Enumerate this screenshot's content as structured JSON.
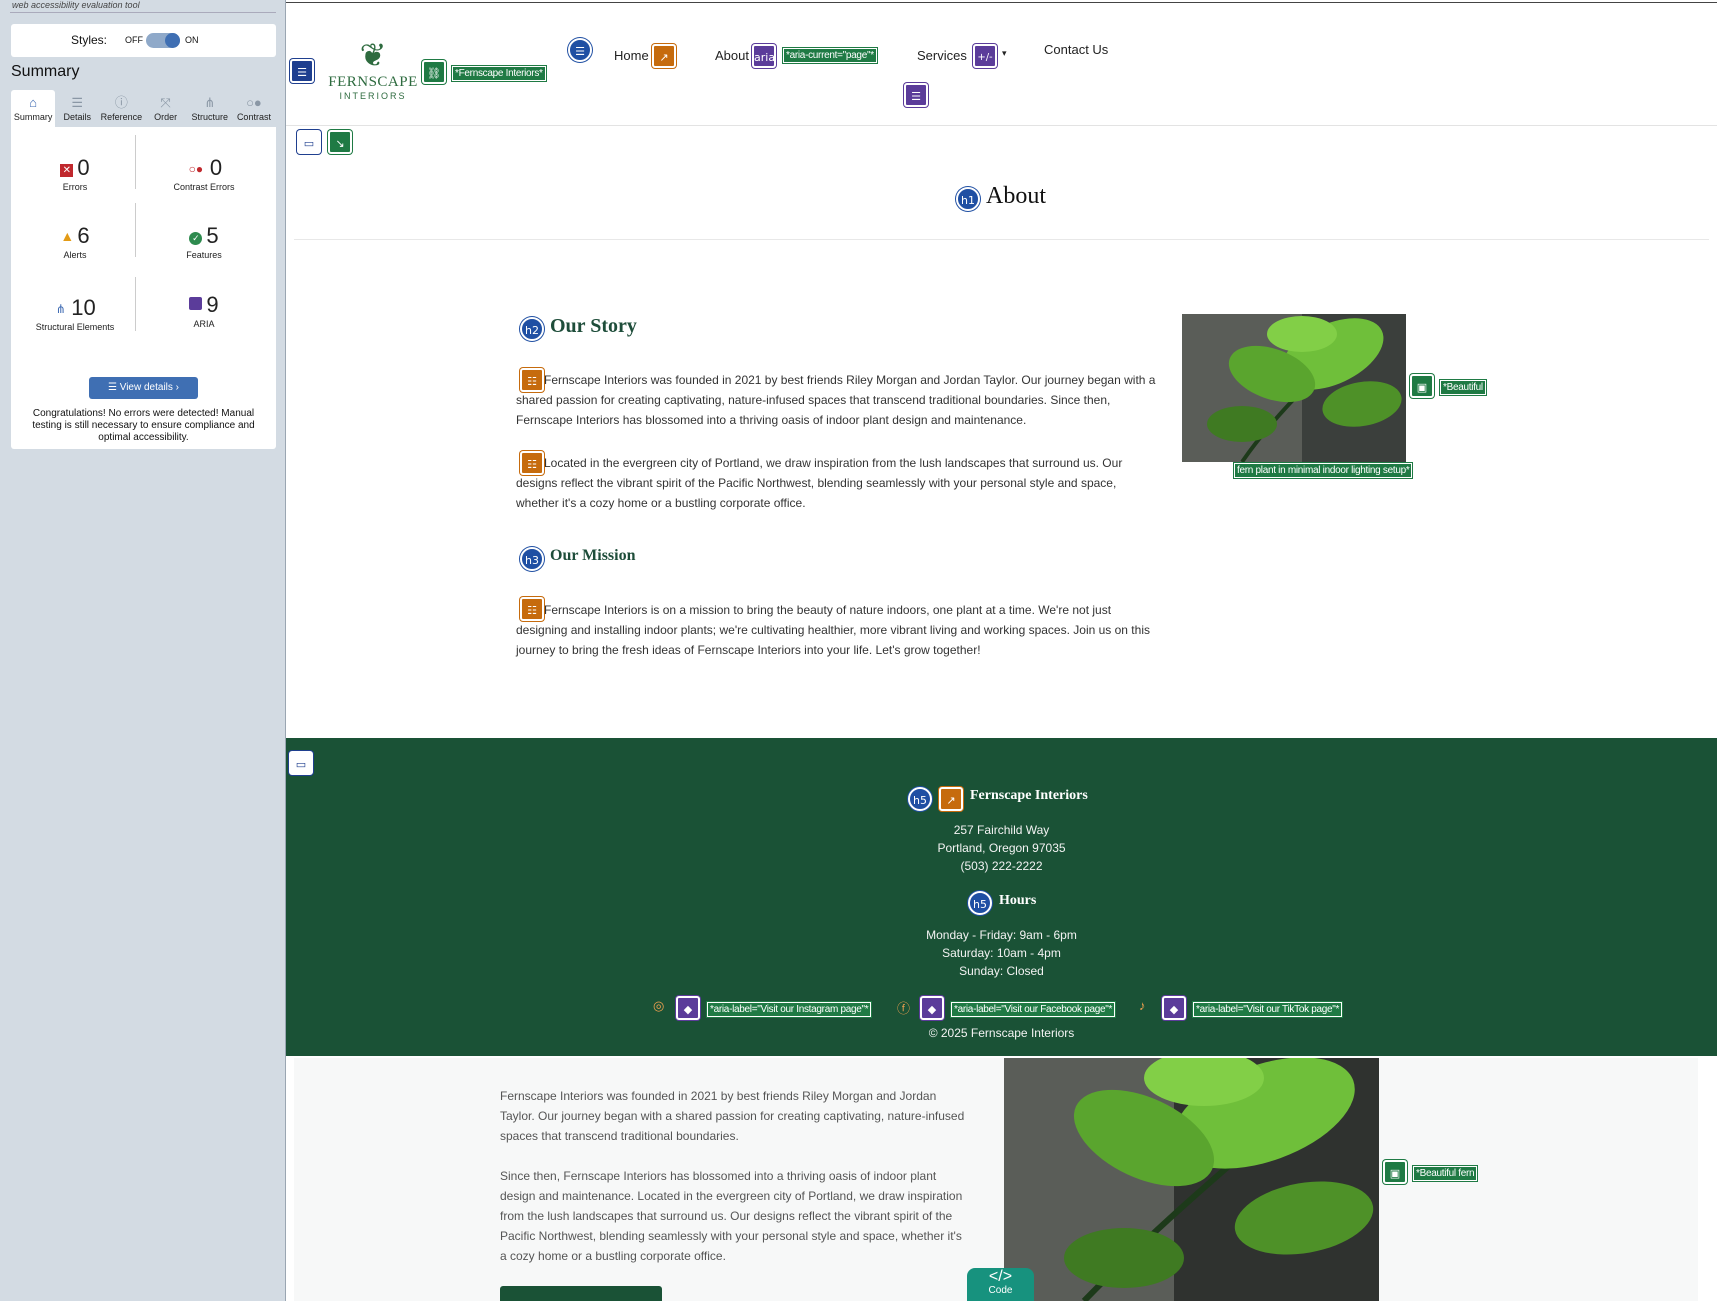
{
  "wave": {
    "tool_tag": "web accessibility evaluation tool",
    "styles_label": "Styles:",
    "off_label": "OFF",
    "on_label": "ON",
    "summary_title": "Summary",
    "tabs": [
      {
        "label": "Summary",
        "icon": "home-icon"
      },
      {
        "label": "Details",
        "icon": "list-icon"
      },
      {
        "label": "Reference",
        "icon": "info-icon"
      },
      {
        "label": "Order",
        "icon": "order-icon"
      },
      {
        "label": "Structure",
        "icon": "structure-icon"
      },
      {
        "label": "Contrast",
        "icon": "contrast-icon"
      }
    ],
    "stats": {
      "errors": {
        "value": "0",
        "label": "Errors"
      },
      "contrast": {
        "value": "0",
        "label": "Contrast Errors"
      },
      "alerts": {
        "value": "6",
        "label": "Alerts"
      },
      "features": {
        "value": "5",
        "label": "Features"
      },
      "structural": {
        "value": "10",
        "label": "Structural Elements"
      },
      "aria": {
        "value": "9",
        "label": "ARIA"
      }
    },
    "view_details": "View details ›",
    "congrats": "Congratulations! No errors were detected! Manual testing is still necessary to ensure compliance and optimal accessibility."
  },
  "site": {
    "logo_name": "FERNSCAPE",
    "logo_sub": "INTERIORS",
    "logo_alt_tag": "*Fernscape Interiors*",
    "nav": {
      "home": "Home",
      "about": "About",
      "aria_badge": "aria",
      "aria_current_tag": "*aria-current=\"page\"*",
      "services": "Services",
      "services_badge": "+/-",
      "contact": "Contact Us"
    },
    "page_title": "About",
    "story_heading": "Our Story",
    "story_p1": "Fernscape Interiors was founded in 2021 by best friends Riley Morgan and Jordan Taylor. Our journey began with a shared passion for creating captivating, nature-infused spaces that transcend traditional boundaries. Since then, Fernscape Interiors has blossomed into a thriving oasis of indoor plant design and maintenance.",
    "story_p2": "Located in the evergreen city of Portland, we draw inspiration from the lush landscapes that surround us. Our designs reflect the vibrant spirit of the Pacific Northwest, blending seamlessly with your personal style and space, whether it's a cozy home or a bustling corporate office.",
    "mission_heading": "Our Mission",
    "mission_p": "Fernscape Interiors is on a mission to bring the beauty of nature indoors, one plant at a time. We're not just designing and installing indoor plants; we're cultivating healthier, more vibrant living and working spaces. Join us on this journey to bring the fresh ideas of Fernscape Interiors into your life. Let's grow together!",
    "image_alt_a": "*Beautiful",
    "image_alt_b": "fern plant in minimal indoor lighting setup*",
    "h_labels": {
      "h1": "h1",
      "h2": "h2",
      "h3": "h3",
      "h5": "h5"
    },
    "footer": {
      "company": "Fernscape Interiors",
      "address1": "257 Fairchild Way",
      "address2": "Portland, Oregon 97035",
      "phone": "(503) 222-2222",
      "hours_heading": "Hours",
      "hours1": "Monday - Friday: 9am - 6pm",
      "hours2": "Saturday: 10am - 4pm",
      "hours3": "Sunday: Closed",
      "instagram_tag": "*aria-label=\"Visit our Instagram page\"*",
      "facebook_tag": "*aria-label=\"Visit our Facebook page\"*",
      "tiktok_tag": "*aria-label=\"Visit our TikTok page\"*",
      "copyright": "© 2025 Fernscape Interiors"
    },
    "lower": {
      "p1": "Fernscape Interiors was founded in 2021 by best friends Riley Morgan and Jordan Taylor. Our journey began with a shared passion for creating captivating, nature-infused spaces that transcend traditional boundaries.",
      "p2": "Since then, Fernscape Interiors has blossomed into a thriving oasis of indoor plant design and maintenance. Located in the evergreen city of Portland, we draw inspiration from the lush landscapes that surround us. Our designs reflect the vibrant spirit of the Pacific Northwest, blending seamlessly with your personal style and space, whether it's a cozy home or a bustling corporate office.",
      "image_alt": "*Beautiful fern",
      "code_label": "Code",
      "code_glyph": "</>"
    }
  }
}
